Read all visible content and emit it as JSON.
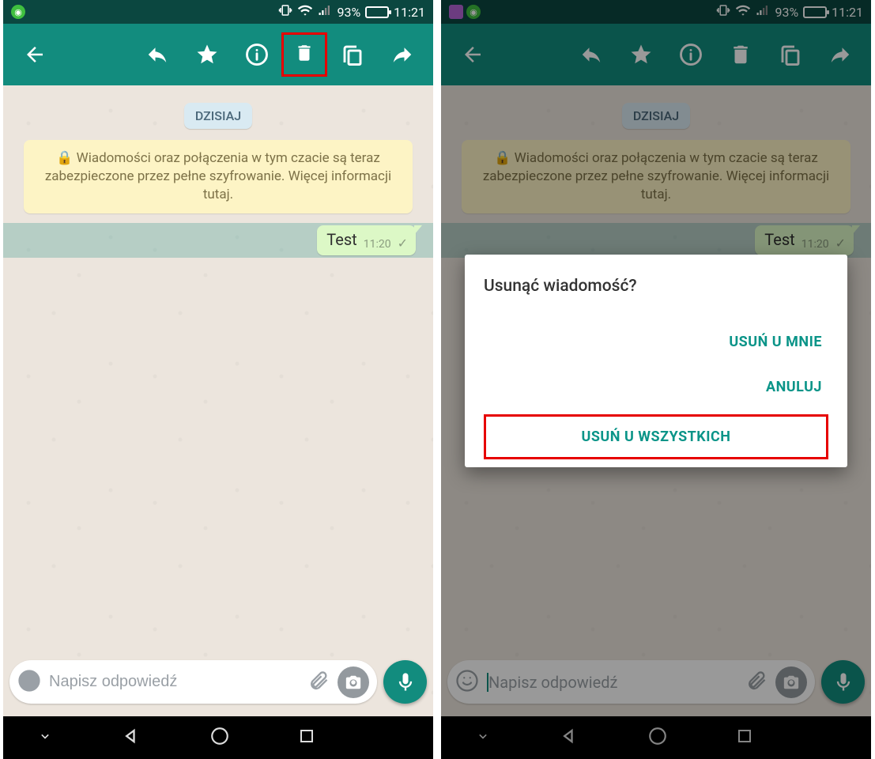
{
  "status": {
    "battery_pct": "93%",
    "clock": "11:21"
  },
  "chat": {
    "date_chip": "DZISIAJ",
    "encryption_notice": "Wiadomości oraz połączenia w tym czacie są teraz zabezpieczone przez pełne szyfrowanie. Więcej informacji tutaj.",
    "message": {
      "text": "Test",
      "time": "11:20"
    },
    "input_placeholder": "Napisz odpowiedź"
  },
  "dialog": {
    "title": "Usunąć wiadomość?",
    "delete_for_me": "USUŃ U MNIE",
    "cancel": "ANULUJ",
    "delete_for_all": "USUŃ U WSZYSTKICH"
  }
}
